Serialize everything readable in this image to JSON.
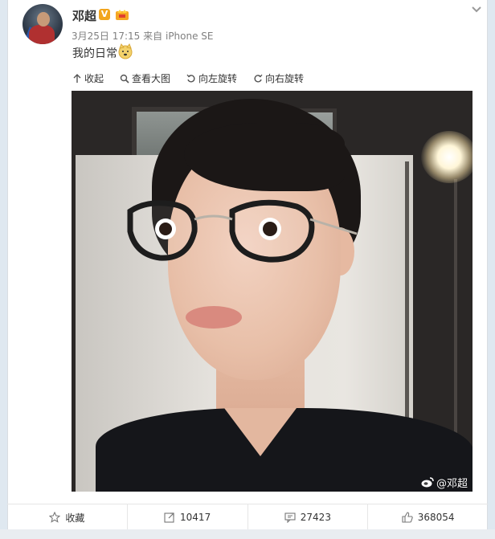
{
  "post": {
    "username": "邓超",
    "verified_badge": "V",
    "meta_date": "3月25日 17:15",
    "meta_from": "来自",
    "meta_device": "iPhone SE",
    "text": "我的日常"
  },
  "toolbar": {
    "collapse": "收起",
    "view_large": "查看大图",
    "rotate_left": "向左旋转",
    "rotate_right": "向右旋转"
  },
  "photo": {
    "watermark_handle": "@邓超"
  },
  "actions": {
    "favorite": "收藏",
    "repost_count": "10417",
    "comment_count": "27423",
    "like_count": "368054"
  },
  "colors": {
    "page_bg": "#dfe8f0",
    "card_bg": "#ffffff",
    "verified": "#f2a51d",
    "text": "#333333",
    "meta": "#808080"
  }
}
